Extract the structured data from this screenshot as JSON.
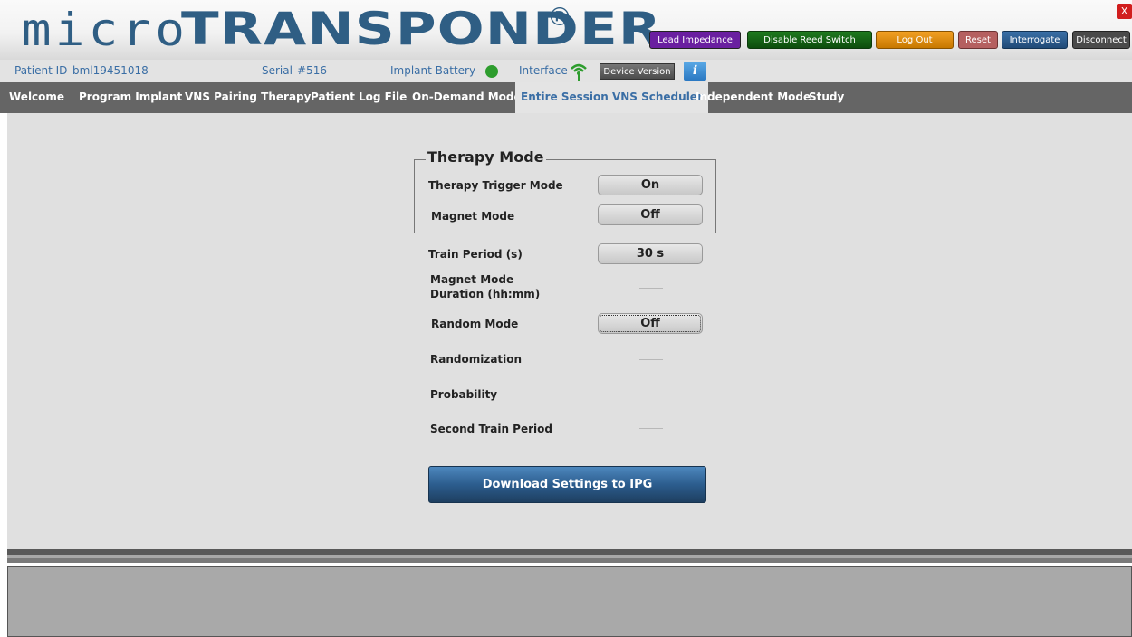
{
  "logo": {
    "part1": "micro",
    "part2": "TRANSPONDER",
    "reg": "®"
  },
  "header_buttons": {
    "lead_impedance": "Lead Impedance",
    "disable_reed_switch": "Disable Reed Switch",
    "log_out": "Log Out",
    "reset": "Reset",
    "interrogate": "Interrogate",
    "disconnect": "Disconnect",
    "close": "X"
  },
  "info_bar": {
    "patient_id_label": "Patient ID",
    "patient_id": "bml19451018",
    "serial_label": "Serial",
    "serial": "#516",
    "battery_label": "Implant Battery",
    "battery_status_color": "#2e9d2e",
    "interface_label": "Interface",
    "interface_icon": "wifi-signal-icon",
    "device_version": "Device Version",
    "info_icon": "i"
  },
  "nav": {
    "tabs": [
      "Welcome",
      "Program Implant",
      "VNS Pairing Therapy",
      "Patient Log File",
      "On-Demand Mode",
      "Entire Session VNS Scheduler",
      "Independent Mode",
      "Study"
    ],
    "active": "Entire Session VNS Scheduler"
  },
  "therapy_mode": {
    "legend": "Therapy Mode",
    "trigger_label": "Therapy Trigger Mode",
    "trigger_value": "On",
    "magnet_label": "Magnet Mode",
    "magnet_value": "Off"
  },
  "settings": {
    "train_period_label": "Train Period (s)",
    "train_period_value": "30 s",
    "magnet_duration_label_1": "Magnet Mode",
    "magnet_duration_label_2": "Duration (hh:mm)",
    "random_mode_label": "Random Mode",
    "random_mode_value": "Off",
    "randomization_label": "Randomization",
    "probability_label": "Probability",
    "second_train_label": "Second Train Period"
  },
  "download_button": "Download Settings to IPG",
  "colors": {
    "brand": "#2f5e84",
    "nav_bg": "#656565",
    "accent_blue": "#3a6ea5"
  }
}
